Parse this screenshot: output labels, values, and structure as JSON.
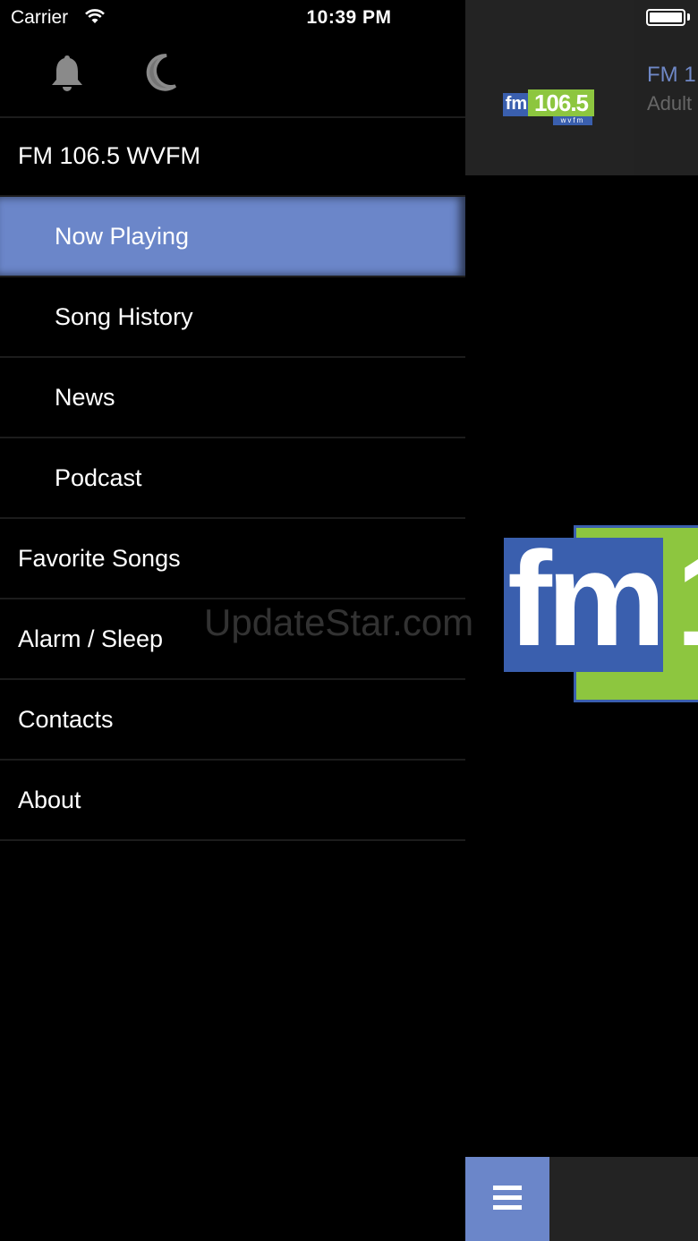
{
  "status_bar": {
    "carrier": "Carrier",
    "time": "10:39 PM"
  },
  "drawer": {
    "icons": [
      "bell-icon",
      "moon-icon"
    ],
    "items": [
      {
        "label": "FM 106.5 WVFM",
        "level": "top",
        "active": false
      },
      {
        "label": "Now Playing",
        "level": "sub",
        "active": true
      },
      {
        "label": "Song History",
        "level": "sub",
        "active": false
      },
      {
        "label": "News",
        "level": "sub",
        "active": false
      },
      {
        "label": "Podcast",
        "level": "sub",
        "active": false
      },
      {
        "label": "Favorite Songs",
        "level": "top",
        "active": false
      },
      {
        "label": "Alarm / Sleep",
        "level": "top",
        "active": false
      },
      {
        "label": "Contacts",
        "level": "top",
        "active": false
      },
      {
        "label": "About",
        "level": "top",
        "active": false
      }
    ]
  },
  "header": {
    "logo": {
      "fm": "fm",
      "number": "106.5",
      "call": "wvfm"
    },
    "station_title": "FM 1",
    "station_subtitle": "Adult"
  },
  "big_logo": {
    "fm": "fm",
    "digit": "1"
  },
  "watermark": "UpdateStar.com",
  "colors": {
    "accent": "#6b86c9",
    "logo_blue": "#3a5fae",
    "logo_green": "#8dc63f",
    "panel": "#232323"
  }
}
